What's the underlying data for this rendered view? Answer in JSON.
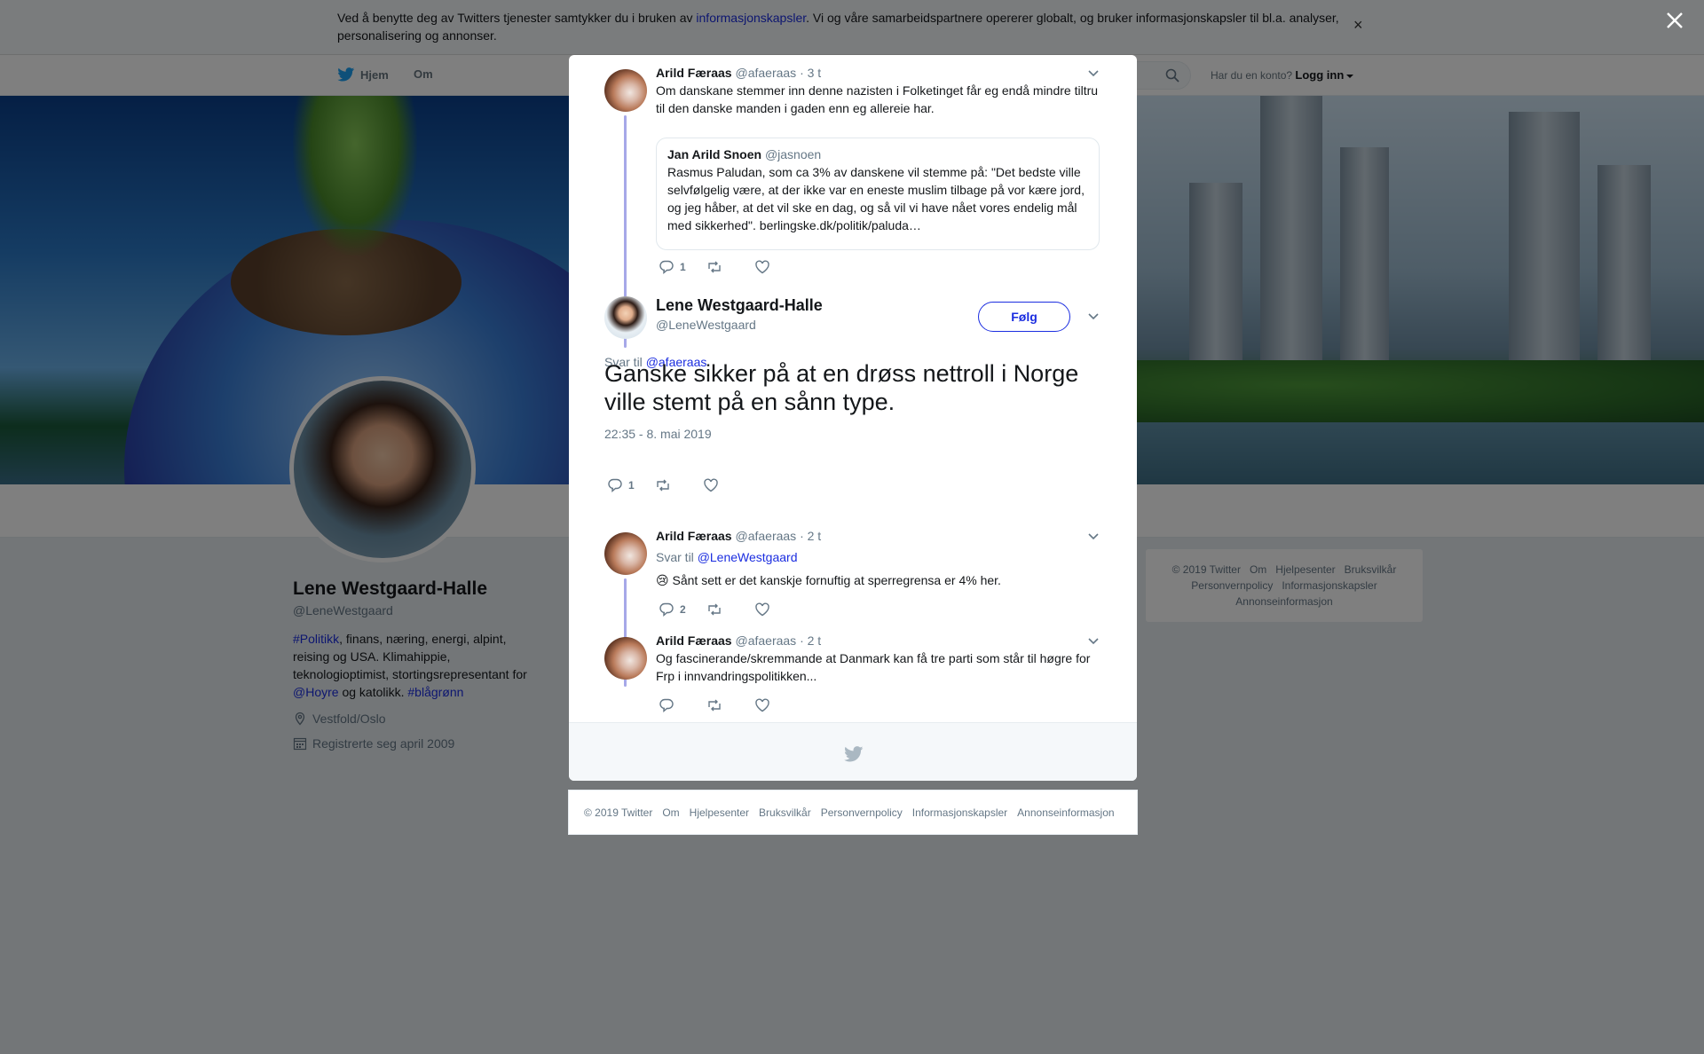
{
  "cookie": {
    "text_before": "Ved å benytte deg av Twitters tjenester samtykker du i bruken av ",
    "link": "informasjonskapsler",
    "text_after": ". Vi og våre samarbeidspartnere opererer globalt, og bruker informasjonskapsler til bl.a. analyser, personalisering og annonser.",
    "close": "×"
  },
  "nav": {
    "home": "Hjem",
    "about": "Om",
    "login_question": "Har du en konto?",
    "login": "Logg inn"
  },
  "profile": {
    "name": "Lene Westgaard-Halle",
    "handle": "@LeneWestgaard",
    "bio_tag1": "#Politikk",
    "bio_text1": ", finans, næring, energi, alpint, reising og USA. Klimahippie, teknologioptimist, stortingsrepresentant for ",
    "bio_mention": "@Hoyre",
    "bio_text2": " og katolikk. ",
    "bio_tag2": "#blågrønn",
    "location": "Vestfold/Oslo",
    "joined": "Registrerte seg april 2009"
  },
  "side_footer": {
    "items": [
      "© 2019 Twitter",
      "Om",
      "Hjelpesenter",
      "Bruksvilkår",
      "Personvernpolicy",
      "Informasjonskapsler",
      "Annonseinformasjon"
    ]
  },
  "tweets": {
    "t1": {
      "name": "Arild Færaas",
      "handle": "@afaeraas",
      "time": "· 3 t",
      "text": "Om danskane stemmer inn denne nazisten i Folketinget får eg endå mindre tiltru til den danske manden i gaden enn eg allereie har.",
      "quote_name": "Jan Arild Snoen",
      "quote_handle": "@jasnoen",
      "quote_text": "Rasmus Paludan, som ca 3% av danskene vil stemme på: \"Det bedste ville selvfølgelig være, at der ikke var en eneste muslim tilbage på vor kære jord, og jeg håber, at det vil ske en dag, og så vil vi have nået vores endelig mål med sikkerhed\". berlingske.dk/politik/paluda…",
      "replies": "1",
      "retweets": "",
      "likes": ""
    },
    "main": {
      "name": "Lene Westgaard-Halle",
      "handle": "@LeneWestgaard",
      "follow": "Følg",
      "reply_prefix": "Svar til ",
      "reply_to": "@afaeraas",
      "text": "Ganske sikker på at en drøss nettroll i Norge ville stemt på en sånn type.",
      "timestamp": "22:35 - 8. mai 2019",
      "replies": "1",
      "retweets": "",
      "likes": ""
    },
    "t2": {
      "name": "Arild Færaas",
      "handle": "@afaeraas",
      "time": "· 2 t",
      "reply_prefix": "Svar til ",
      "reply_to": "@LeneWestgaard",
      "emoji": "😢",
      "text": " Sånt sett er det kanskje fornuftig at sperregrensa er 4% her.",
      "replies": "2",
      "retweets": "",
      "likes": ""
    },
    "t3": {
      "name": "Arild Færaas",
      "handle": "@afaeraas",
      "time": "· 2 t",
      "text": "Og fascinerande/skremmande at Danmark kan få tre parti som står til høgre for Frp i innvandringspolitikken...",
      "replies": "",
      "retweets": "",
      "likes": ""
    }
  },
  "bottom_footer": {
    "items": [
      "© 2019 Twitter",
      "Om",
      "Hjelpesenter",
      "Bruksvilkår",
      "Personvernpolicy",
      "Informasjonskapsler",
      "Annonseinformasjon"
    ]
  },
  "colors": {
    "link": "#1b2de0",
    "muted": "#657786",
    "thread_line": "#a6a8e8",
    "overlay": "#6b7173"
  },
  "icons": [
    "twitter-bird-icon",
    "search-icon",
    "location-icon",
    "calendar-icon",
    "chevron-down-icon",
    "reply-icon",
    "retweet-icon",
    "like-icon",
    "close-icon"
  ]
}
